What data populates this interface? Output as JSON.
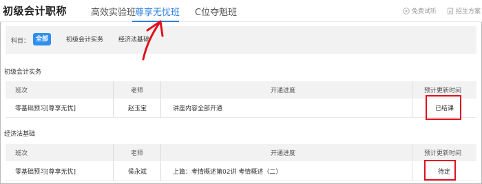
{
  "header": {
    "brand": "初级会计职称",
    "tabs": [
      {
        "label": "高效实验班"
      },
      {
        "label": "尊享无忧班"
      },
      {
        "label": "C位夺魁班"
      }
    ],
    "tools": {
      "free_trial": "免费试听",
      "enroll": "招生方案"
    }
  },
  "filter": {
    "label": "科目：",
    "options": [
      "全部",
      "初级会计实务",
      "经济法基础"
    ]
  },
  "columns": {
    "class": "班次",
    "teacher": "老师",
    "progress": "开通进度",
    "update_time": "预计更新时间"
  },
  "sections": [
    {
      "title": "初级会计实务",
      "rows": [
        {
          "class": "零基础预习[尊享无忧]",
          "teacher": "赵玉宝",
          "progress": "讲座内容全部开通",
          "status": "已结课"
        }
      ]
    },
    {
      "title": "经济法基础",
      "rows": [
        {
          "class": "零基础预习[尊享无忧]",
          "teacher": "侯永斌",
          "progress": "上篇：考情概述第02讲  考情概述（二）",
          "status": "待定"
        }
      ]
    }
  ],
  "colors": {
    "accent": "#2f7fe0",
    "highlight": "#e0101e",
    "header_bg": "#f2f2f2"
  }
}
